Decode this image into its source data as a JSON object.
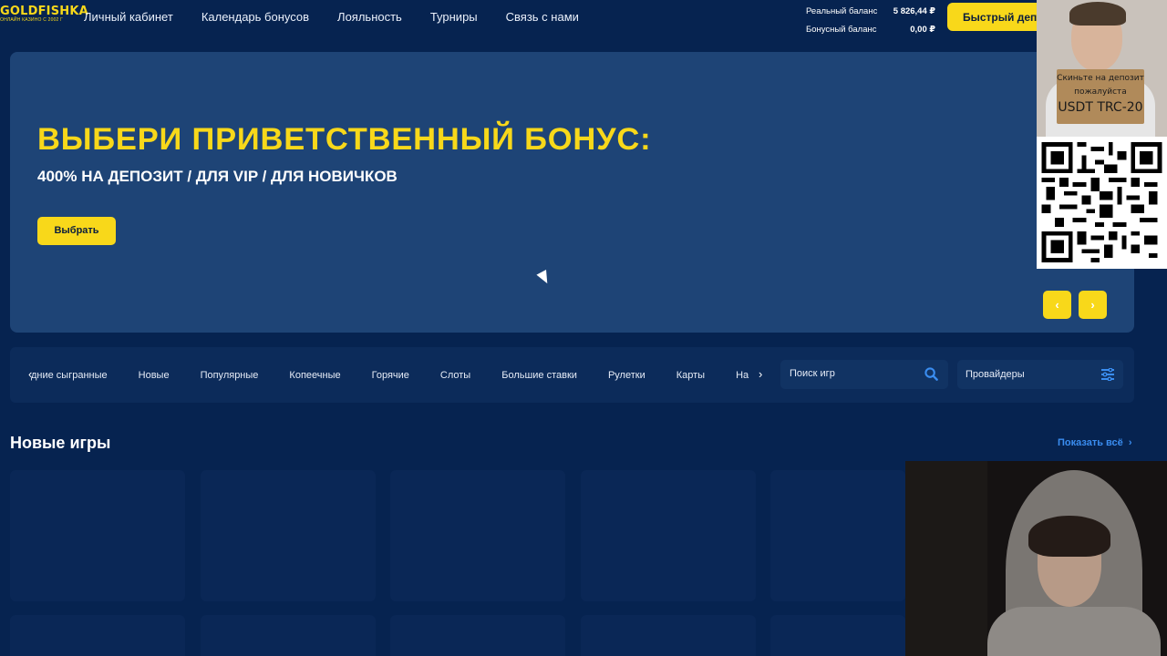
{
  "header": {
    "logo_main": "GOLDFISHKA",
    "logo_sub": "ОНЛАЙН КАЗИНО С 2002 Г",
    "nav": [
      "Личный кабинет",
      "Календарь бонусов",
      "Лояльность",
      "Турниры",
      "Связь с нами"
    ],
    "real_balance_label": "Реальный баланс",
    "real_balance_value": "5 826,44 ₽",
    "bonus_balance_label": "Бонусный баланс",
    "bonus_balance_value": "0,00 ₽",
    "deposit_button": "Быстрый депо"
  },
  "banner": {
    "title": "ВЫБЕРИ ПРИВЕТСТВЕННЫЙ БОНУС:",
    "subtitle": "400% НА ДЕПОЗИТ / ДЛЯ VIP / ДЛЯ НОВИЧКОВ",
    "button": "Выбрать",
    "prev": "‹",
    "next": "›"
  },
  "categories": {
    "prev_arrow": "‹",
    "next_arrow": "›",
    "items": [
      "дние сыгранные",
      "Новые",
      "Популярные",
      "Копеечные",
      "Горячие",
      "Слоты",
      "Большие ставки",
      "Рулетки",
      "Карты",
      "На"
    ],
    "search_placeholder": "Поиск игр",
    "providers": "Провайдеры"
  },
  "new_games": {
    "title": "Новые игры",
    "show_all": "Показать всё"
  },
  "overlay": {
    "sign_line1": "Скиньте на депозит",
    "sign_line2": "пожалуйста",
    "sign_line3": "USDT TRC-20"
  },
  "colors": {
    "background": "#062350",
    "accent": "#f8d81a",
    "banner": "#1e4476",
    "link": "#3a8df0"
  },
  "icons": [
    "search-icon",
    "filter-icon",
    "chevron-right-icon",
    "chevron-left-icon",
    "mouse-cursor-icon",
    "qr-code-icon"
  ]
}
